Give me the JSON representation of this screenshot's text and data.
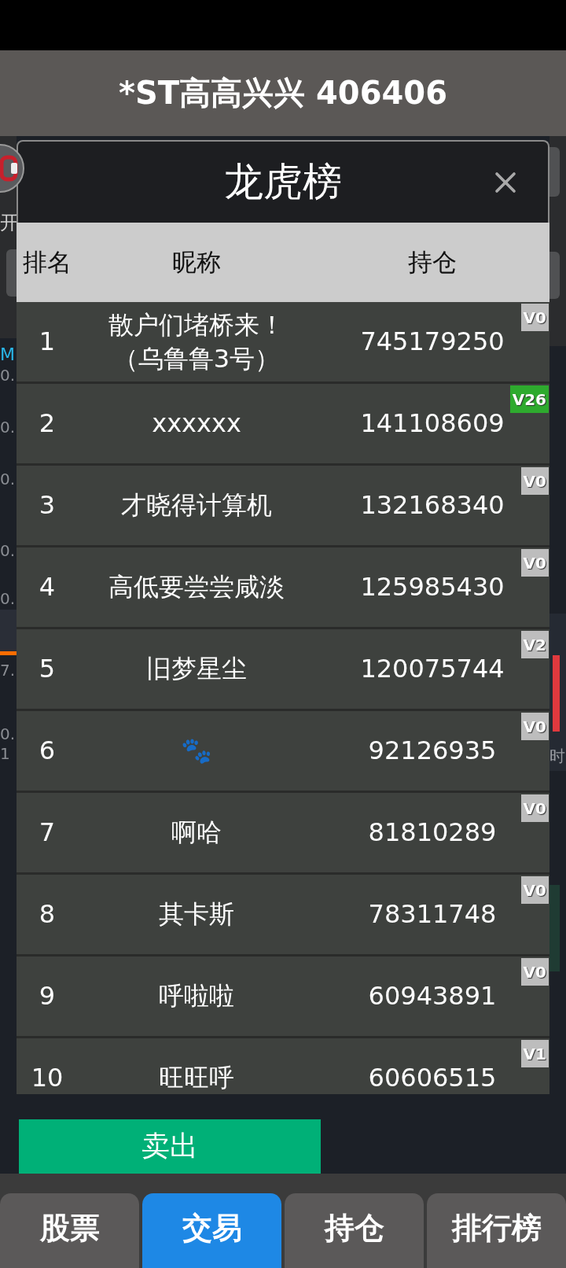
{
  "header": {
    "title": "*ST高高兴兴 406406"
  },
  "background": {
    "left_edge": {
      "label": "开",
      "chart_label": "M",
      "axis_labels": [
        "0.",
        "0.",
        "0.",
        "0.",
        "0."
      ],
      "lower_axis_labels": [
        "7.",
        "0.",
        "1"
      ]
    },
    "right_edge": {
      "label": "时"
    }
  },
  "dialog": {
    "title": "龙虎榜",
    "columns": [
      "排名",
      "昵称",
      "持仓"
    ],
    "rows": [
      {
        "rank": "1",
        "nickname": "散户们堵桥来！（乌鲁鲁3号）",
        "holding": "745179250",
        "badge": {
          "text": "V0",
          "color": "#bdbdbd"
        }
      },
      {
        "rank": "2",
        "nickname": "xxxxxx",
        "holding": "141108609",
        "badge": {
          "text": "V26",
          "color": "#2eaa2e"
        }
      },
      {
        "rank": "3",
        "nickname": "才晓得计算机",
        "holding": "132168340",
        "badge": {
          "text": "V0",
          "color": "#bdbdbd"
        }
      },
      {
        "rank": "4",
        "nickname": "高低要尝尝咸淡",
        "holding": "125985430",
        "badge": {
          "text": "V0",
          "color": "#bdbdbd"
        }
      },
      {
        "rank": "5",
        "nickname": "旧梦星尘",
        "holding": "120075744",
        "badge": {
          "text": "V2",
          "color": "#bdbdbd"
        }
      },
      {
        "rank": "6",
        "nickname": "🐾",
        "holding": "92126935",
        "badge": {
          "text": "V0",
          "color": "#bdbdbd"
        }
      },
      {
        "rank": "7",
        "nickname": "啊哈",
        "holding": "81810289",
        "badge": {
          "text": "V0",
          "color": "#bdbdbd"
        }
      },
      {
        "rank": "8",
        "nickname": "其卡斯",
        "holding": "78311748",
        "badge": {
          "text": "V0",
          "color": "#bdbdbd"
        }
      },
      {
        "rank": "9",
        "nickname": "呼啦啦",
        "holding": "60943891",
        "badge": {
          "text": "V0",
          "color": "#bdbdbd"
        }
      },
      {
        "rank": "10",
        "nickname": "旺旺呼",
        "holding": "60606515",
        "badge": {
          "text": "V1",
          "color": "#bdbdbd"
        }
      }
    ]
  },
  "actions": {
    "sell": "卖出"
  },
  "tabs": [
    {
      "label": "股票",
      "selected": false
    },
    {
      "label": "交易",
      "selected": true
    },
    {
      "label": "持仓",
      "selected": false
    },
    {
      "label": "排行榜",
      "selected": false
    }
  ]
}
